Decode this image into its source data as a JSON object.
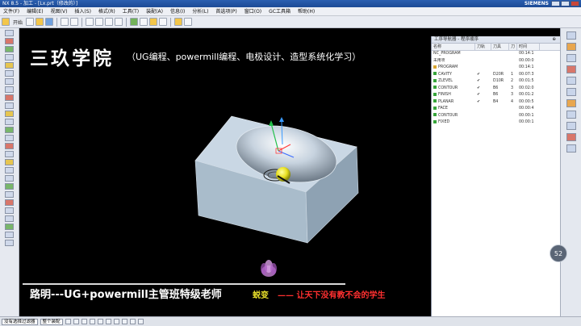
{
  "titlebar": {
    "title": "NX 8.5 - 加工 - [Lx.prt（修改的）]",
    "brand": "SIEMENS"
  },
  "menu": [
    "文件(F)",
    "编辑(E)",
    "视图(V)",
    "插入(S)",
    "格式(R)",
    "工具(T)",
    "装配(A)",
    "信息(I)",
    "分析(L)",
    "首选项(P)",
    "窗口(O)",
    "GC工具箱",
    "帮助(H)"
  ],
  "toolbar": {
    "start_label": "开始",
    "filter_label": "整个装配"
  },
  "viewport": {
    "title": "三玖学院",
    "subtitle": "（UG编程、powermill编程、电极设计、造型系统化学习）",
    "teacher": "路明---UG+powermill主管班特级老师",
    "brand_mark": "蜕变",
    "slogan": "—— 让天下没有教不会的学生"
  },
  "navigator": {
    "title": "工序导航器 - 程序顺序",
    "columns": [
      "名称",
      "刀轨",
      "刀具",
      "刀",
      "时间"
    ],
    "rows": [
      {
        "name": "NC_PROGRAM",
        "path": "",
        "tool": "",
        "no": "",
        "time": "00:14:1",
        "marker": "none"
      },
      {
        "name": "未用项",
        "path": "",
        "tool": "",
        "no": "",
        "time": "00:00:0",
        "marker": "none"
      },
      {
        "name": "PROGRAM",
        "path": "",
        "tool": "",
        "no": "",
        "time": "00:14:1",
        "marker": "fold"
      },
      {
        "name": "CAVITY",
        "path": "✔",
        "tool": "D20R",
        "no": "1",
        "time": "00:07:3",
        "marker": "ok"
      },
      {
        "name": "ZLEVEL",
        "path": "✔",
        "tool": "D10R",
        "no": "2",
        "time": "00:01:5",
        "marker": "ok"
      },
      {
        "name": "CONTOUR",
        "path": "✔",
        "tool": "B6",
        "no": "3",
        "time": "00:02:0",
        "marker": "ok"
      },
      {
        "name": "FINISH",
        "path": "✔",
        "tool": "B6",
        "no": "3",
        "time": "00:01:2",
        "marker": "ok"
      },
      {
        "name": "PLANAR",
        "path": "✔",
        "tool": "B4",
        "no": "4",
        "time": "00:00:5",
        "marker": "ok"
      },
      {
        "name": "FACE",
        "path": "",
        "tool": "",
        "no": "",
        "time": "00:00:4",
        "marker": "ok"
      },
      {
        "name": "CONTOUR",
        "path": "",
        "tool": "",
        "no": "",
        "time": "00:00:1",
        "marker": "ok"
      },
      {
        "name": "FIXED",
        "path": "",
        "tool": "",
        "no": "",
        "time": "00:00:1",
        "marker": "ok"
      }
    ]
  },
  "speed_badge": "52",
  "statusbar": {
    "selection": "没有选择过滤器",
    "scope": "整个装配"
  },
  "colors": {
    "block_top": "#c9d7e4",
    "block_side": "#a9bccb",
    "highlight": "#e8e020",
    "slogan": "#ff3030"
  }
}
